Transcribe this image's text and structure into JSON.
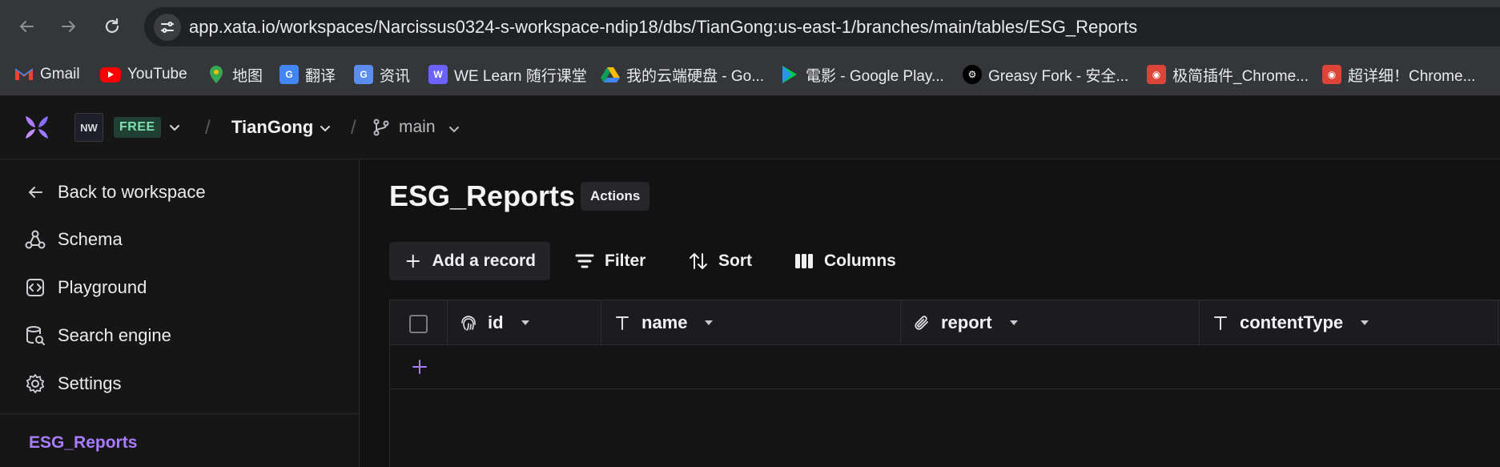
{
  "browser": {
    "url": "app.xata.io/workspaces/Narcissus0324-s-workspace-ndip18/dbs/TianGong:us-east-1/branches/main/tables/ESG_Reports",
    "bookmarks": [
      {
        "label": "Gmail",
        "icon": "gmail-icon",
        "color": "#ea4335"
      },
      {
        "label": "YouTube",
        "icon": "youtube-icon",
        "color": "#ff0000"
      },
      {
        "label": "地图",
        "icon": "maps-icon",
        "color": "#34a853"
      },
      {
        "label": "翻译",
        "icon": "translate-icon",
        "color": "#4285f4"
      },
      {
        "label": "资讯",
        "icon": "news-icon",
        "color": "#5b8def"
      },
      {
        "label": "WE Learn 随行课堂",
        "icon": "welearn-icon",
        "color": "#6c63ff"
      },
      {
        "label": "我的云端硬盘 - Go...",
        "icon": "drive-icon",
        "color": "#fbbc04"
      },
      {
        "label": "電影 - Google Play...",
        "icon": "play-icon",
        "color": "#00c853"
      },
      {
        "label": "Greasy Fork - 安全...",
        "icon": "greasyfork-icon",
        "color": "#000000"
      },
      {
        "label": "极简插件_Chrome...",
        "icon": "chrome-store-icon",
        "color": "#db4437"
      },
      {
        "label": "超详细！Chrome...",
        "icon": "chrome-store-icon",
        "color": "#db4437"
      }
    ]
  },
  "header": {
    "workspace_initials": "NW",
    "plan_badge": "FREE",
    "database": "TianGong",
    "branch": "main",
    "separator": "/"
  },
  "sidebar": {
    "items": [
      {
        "label": "Back to workspace",
        "icon": "arrow-left-icon"
      },
      {
        "label": "Schema",
        "icon": "schema-icon"
      },
      {
        "label": "Playground",
        "icon": "playground-icon"
      },
      {
        "label": "Search engine",
        "icon": "search-engine-icon"
      },
      {
        "label": "Settings",
        "icon": "gear-icon"
      }
    ],
    "active_table": "ESG_Reports"
  },
  "main": {
    "title": "ESG_Reports",
    "actions_label": "Actions",
    "toolbar": {
      "add_record": "Add a record",
      "filter": "Filter",
      "sort": "Sort",
      "columns": "Columns"
    },
    "columns": [
      {
        "name": "id",
        "type_icon": "fingerprint-icon"
      },
      {
        "name": "name",
        "type_icon": "text-type-icon"
      },
      {
        "name": "report",
        "type_icon": "attachment-icon"
      },
      {
        "name": "contentType",
        "type_icon": "text-type-icon"
      }
    ]
  },
  "colors": {
    "accent": "#a97dff",
    "free_badge_text": "#7fe0b0",
    "background": "#121212"
  }
}
